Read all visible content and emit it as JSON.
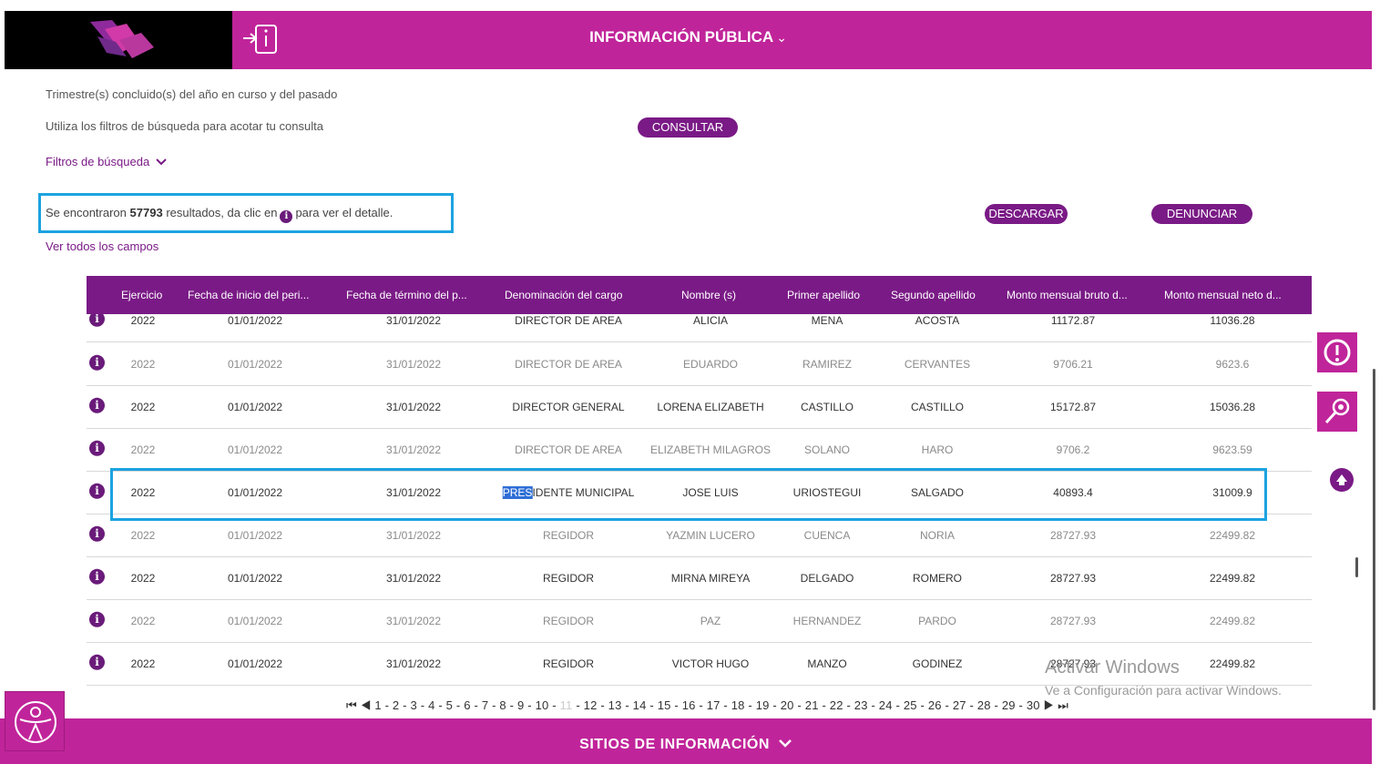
{
  "header": {
    "title": "INFORMACIÓN PÚBLICA",
    "chevron": "⌄"
  },
  "intro": {
    "line1": "Trimestre(s) concluido(s) del año en curso y del pasado",
    "line2": "Utiliza los filtros de búsqueda para acotar tu consulta",
    "consultar_label": "CONSULTAR",
    "filtros_label": "Filtros de búsqueda"
  },
  "results": {
    "prefix": "Se encontraron",
    "count": "57793",
    "suffix_a": "resultados, da clic en",
    "info_glyph": "i",
    "suffix_b": "para ver el detalle."
  },
  "actions": {
    "descargar_label": "DESCARGAR",
    "denunciar_label": "DENUNCIAR",
    "ver_todos_label": "Ver todos los campos"
  },
  "table": {
    "columns": [
      "Ejercicio",
      "Fecha de inicio del peri...",
      "Fecha de término del p...",
      "Denominación del cargo",
      "Nombre (s)",
      "Primer apellido",
      "Segundo apellido",
      "Monto mensual bruto d...",
      "Monto mensual neto d..."
    ],
    "rows": [
      [
        "2022",
        "01/01/2022",
        "31/01/2022",
        "DIRECTOR DE AREA",
        "ALICIA",
        "MENA",
        "ACOSTA",
        "11172.87",
        "11036.28"
      ],
      [
        "2022",
        "01/01/2022",
        "31/01/2022",
        "DIRECTOR DE AREA",
        "EDUARDO",
        "RAMIREZ",
        "CERVANTES",
        "9706.21",
        "9623.6"
      ],
      [
        "2022",
        "01/01/2022",
        "31/01/2022",
        "DIRECTOR GENERAL",
        "LORENA ELIZABETH",
        "CASTILLO",
        "CASTILLO",
        "15172.87",
        "15036.28"
      ],
      [
        "2022",
        "01/01/2022",
        "31/01/2022",
        "DIRECTOR DE AREA",
        "ELIZABETH MILAGROS",
        "SOLANO",
        "HARO",
        "9706.2",
        "9623.59"
      ],
      [
        "2022",
        "01/01/2022",
        "31/01/2022",
        "PRESIDENTE MUNICIPAL",
        "JOSE LUIS",
        "URIOSTEGUI",
        "SALGADO",
        "40893.4",
        "31009.9"
      ],
      [
        "2022",
        "01/01/2022",
        "31/01/2022",
        "REGIDOR",
        "YAZMIN LUCERO",
        "CUENCA",
        "NORIA",
        "28727.93",
        "22499.82"
      ],
      [
        "2022",
        "01/01/2022",
        "31/01/2022",
        "REGIDOR",
        "MIRNA MIREYA",
        "DELGADO",
        "ROMERO",
        "28727.93",
        "22499.82"
      ],
      [
        "2022",
        "01/01/2022",
        "31/01/2022",
        "REGIDOR",
        "PAZ",
        "HERNANDEZ",
        "PARDO",
        "28727.93",
        "22499.82"
      ],
      [
        "2022",
        "01/01/2022",
        "31/01/2022",
        "REGIDOR",
        "VICTOR HUGO",
        "MANZO",
        "GODINEZ",
        "28727.93",
        "22499.82"
      ]
    ],
    "highlight_prefix": "PRES",
    "highlight_rest": "IDENTE MUNICIPAL"
  },
  "pager": {
    "first": "⏮",
    "prev": "◀",
    "before": "1 - 2 - 3 - 4 - 5 - 6 - 7 - 8 - 9 - 10 -",
    "current": "11",
    "after": "- 12 - 13 - 14 - 15 - 16 - 17 - 18 - 19 - 20 - 21 - 22 - 23 - 24 - 25 - 26 - 27 - 28 - 29 - 30",
    "next": "▶",
    "last": "⏭"
  },
  "watermark": {
    "line1": "Activar Windows",
    "line2": "Ve a Configuración para activar Windows."
  },
  "footer": {
    "title": "SITIOS DE INFORMACIÓN",
    "chevron": "⌄"
  },
  "colors": {
    "magenta": "#c0249a",
    "purple": "#7a1a86",
    "highlight_box": "#1ba3e0"
  }
}
